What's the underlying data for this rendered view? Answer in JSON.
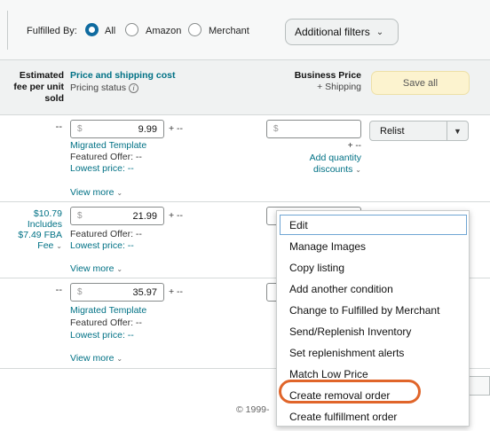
{
  "filter": {
    "label": "Fulfilled By:",
    "options": [
      "All",
      "Amazon",
      "Merchant"
    ],
    "selected": "All",
    "additional_filters": "Additional filters"
  },
  "header": {
    "fee": [
      "Estimated",
      "fee per unit",
      "sold"
    ],
    "price_title": "Price and shipping cost",
    "pricing_status": "Pricing status",
    "business_price": "Business Price",
    "plus_shipping": "+ Shipping",
    "save_all": "Save all"
  },
  "rows": [
    {
      "fee": "--",
      "currency": "$",
      "price": "9.99",
      "plus": "+ --",
      "template": "Migrated Template",
      "featured": "Featured Offer: --",
      "lowest": "Lowest price: --",
      "view_more": "View more",
      "biz_currency": "$",
      "biz_plus": "+ --",
      "qty_line1": "Add quantity",
      "qty_line2": "discounts",
      "action": "Relist"
    },
    {
      "fee_lines": [
        "$10.79",
        "Includes",
        "$7.49 FBA",
        "Fee"
      ],
      "currency": "$",
      "price": "21.99",
      "plus": "+ --",
      "featured": "Featured Offer: --",
      "lowest": "Lowest price: --",
      "view_more": "View more"
    },
    {
      "fee": "--",
      "currency": "$",
      "price": "35.97",
      "plus": "+ --",
      "template": "Migrated Template",
      "featured": "Featured Offer: --",
      "lowest": "Lowest price: --",
      "view_more": "View more"
    }
  ],
  "menu": {
    "items": [
      "Edit",
      "Manage Images",
      "Copy listing",
      "Add another condition",
      "Change to Fulfilled by Merchant",
      "Send/Replenish Inventory",
      "Set replenishment alerts",
      "Match Low Price",
      "Create removal order",
      "Create fulfillment order"
    ],
    "highlighted": "Create removal order",
    "highlight_color": "#e0652a"
  },
  "footer": {
    "copyright": "© 1999-"
  },
  "colors": {
    "link": "#007185",
    "radio": "#0f6ba0",
    "save_all_bg": "#fcf3cf"
  }
}
